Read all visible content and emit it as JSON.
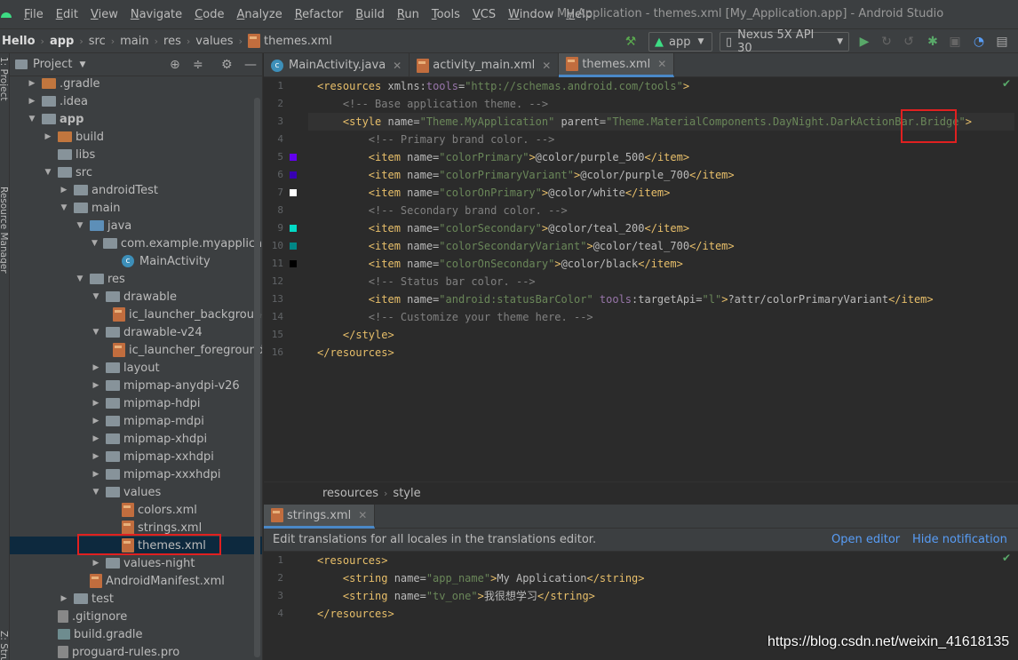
{
  "window": {
    "title": "My Application - themes.xml [My_Application.app] - Android Studio",
    "menus": [
      "File",
      "Edit",
      "View",
      "Navigate",
      "Code",
      "Analyze",
      "Refactor",
      "Build",
      "Run",
      "Tools",
      "VCS",
      "Window",
      "Help"
    ]
  },
  "breadcrumb": [
    "Hello",
    "app",
    "src",
    "main",
    "res",
    "values",
    "themes.xml"
  ],
  "toolbar": {
    "run_config": "app",
    "device": "Nexus 5X API 30"
  },
  "left_stripe": {
    "project": "1: Project",
    "resource_manager": "Resource Manager",
    "structure": "Z: Structure"
  },
  "project_panel": {
    "title": "Project",
    "tree": [
      {
        "label": ".gradle",
        "depth": 0,
        "arrow": "closed",
        "icon": "folder-orange"
      },
      {
        "label": ".idea",
        "depth": 0,
        "arrow": "closed",
        "icon": "folder"
      },
      {
        "label": "app",
        "depth": 0,
        "arrow": "open",
        "icon": "folder-module"
      },
      {
        "label": "build",
        "depth": 1,
        "arrow": "closed",
        "icon": "folder-orange"
      },
      {
        "label": "libs",
        "depth": 1,
        "arrow": "none",
        "icon": "folder"
      },
      {
        "label": "src",
        "depth": 1,
        "arrow": "open",
        "icon": "folder"
      },
      {
        "label": "androidTest",
        "depth": 2,
        "arrow": "closed",
        "icon": "folder"
      },
      {
        "label": "main",
        "depth": 2,
        "arrow": "open",
        "icon": "folder"
      },
      {
        "label": "java",
        "depth": 3,
        "arrow": "open",
        "icon": "folder-blue"
      },
      {
        "label": "com.example.myapplication",
        "depth": 4,
        "arrow": "open",
        "icon": "package"
      },
      {
        "label": "MainActivity",
        "depth": 5,
        "arrow": "none",
        "icon": "class"
      },
      {
        "label": "res",
        "depth": 3,
        "arrow": "open",
        "icon": "folder"
      },
      {
        "label": "drawable",
        "depth": 4,
        "arrow": "open",
        "icon": "folder"
      },
      {
        "label": "ic_launcher_background.xml",
        "depth": 5,
        "arrow": "none",
        "icon": "xml"
      },
      {
        "label": "drawable-v24",
        "depth": 4,
        "arrow": "open",
        "icon": "folder"
      },
      {
        "label": "ic_launcher_foreground.xml",
        "depth": 5,
        "arrow": "none",
        "icon": "xml"
      },
      {
        "label": "layout",
        "depth": 4,
        "arrow": "closed",
        "icon": "folder"
      },
      {
        "label": "mipmap-anydpi-v26",
        "depth": 4,
        "arrow": "closed",
        "icon": "folder"
      },
      {
        "label": "mipmap-hdpi",
        "depth": 4,
        "arrow": "closed",
        "icon": "folder"
      },
      {
        "label": "mipmap-mdpi",
        "depth": 4,
        "arrow": "closed",
        "icon": "folder"
      },
      {
        "label": "mipmap-xhdpi",
        "depth": 4,
        "arrow": "closed",
        "icon": "folder"
      },
      {
        "label": "mipmap-xxhdpi",
        "depth": 4,
        "arrow": "closed",
        "icon": "folder"
      },
      {
        "label": "mipmap-xxxhdpi",
        "depth": 4,
        "arrow": "closed",
        "icon": "folder"
      },
      {
        "label": "values",
        "depth": 4,
        "arrow": "open",
        "icon": "folder"
      },
      {
        "label": "colors.xml",
        "depth": 5,
        "arrow": "none",
        "icon": "xml"
      },
      {
        "label": "strings.xml",
        "depth": 5,
        "arrow": "none",
        "icon": "xml"
      },
      {
        "label": "themes.xml",
        "depth": 5,
        "arrow": "none",
        "icon": "xml",
        "selected": true
      },
      {
        "label": "values-night",
        "depth": 4,
        "arrow": "closed",
        "icon": "folder"
      },
      {
        "label": "AndroidManifest.xml",
        "depth": 3,
        "arrow": "none",
        "icon": "manifest"
      },
      {
        "label": "test",
        "depth": 2,
        "arrow": "closed",
        "icon": "folder"
      },
      {
        "label": ".gitignore",
        "depth": 1,
        "arrow": "none",
        "icon": "file"
      },
      {
        "label": "build.gradle",
        "depth": 1,
        "arrow": "none",
        "icon": "gradle"
      },
      {
        "label": "proguard-rules.pro",
        "depth": 1,
        "arrow": "none",
        "icon": "file"
      }
    ]
  },
  "editor_tabs": [
    {
      "label": "MainActivity.java",
      "icon": "class",
      "active": false
    },
    {
      "label": "activity_main.xml",
      "icon": "xml",
      "active": false
    },
    {
      "label": "themes.xml",
      "icon": "xml",
      "active": true
    }
  ],
  "themes_xml": {
    "lines": [
      [
        [
          "tg",
          "<resources "
        ],
        [
          "at",
          "xmlns:"
        ],
        [
          "ns",
          "tools"
        ],
        [
          "at",
          "="
        ],
        [
          "av",
          "\"http://schemas.android.com/tools\""
        ],
        [
          "tg",
          ">"
        ]
      ],
      [
        [
          "cm",
          "    <!-- Base application theme. -->"
        ]
      ],
      [
        [
          "tg",
          "    <style "
        ],
        [
          "at",
          "name="
        ],
        [
          "av",
          "\"Theme.MyApplication\""
        ],
        [
          "at",
          " parent="
        ],
        [
          "av",
          "\"Theme.MaterialComponents.DayNight.DarkActionBar.Bridge\""
        ],
        [
          "tg",
          ">"
        ]
      ],
      [
        [
          "cm",
          "        <!-- Primary brand color. -->"
        ]
      ],
      [
        [
          "tg",
          "        <item "
        ],
        [
          "at",
          "name="
        ],
        [
          "av",
          "\"colorPrimary\""
        ],
        [
          "tg",
          ">"
        ],
        [
          "at",
          "@color/purple_500"
        ],
        [
          "tg",
          "</item>"
        ]
      ],
      [
        [
          "tg",
          "        <item "
        ],
        [
          "at",
          "name="
        ],
        [
          "av",
          "\"colorPrimaryVariant\""
        ],
        [
          "tg",
          ">"
        ],
        [
          "at",
          "@color/purple_700"
        ],
        [
          "tg",
          "</item>"
        ]
      ],
      [
        [
          "tg",
          "        <item "
        ],
        [
          "at",
          "name="
        ],
        [
          "av",
          "\"colorOnPrimary\""
        ],
        [
          "tg",
          ">"
        ],
        [
          "at",
          "@color/white"
        ],
        [
          "tg",
          "</item>"
        ]
      ],
      [
        [
          "cm",
          "        <!-- Secondary brand color. -->"
        ]
      ],
      [
        [
          "tg",
          "        <item "
        ],
        [
          "at",
          "name="
        ],
        [
          "av",
          "\"colorSecondary\""
        ],
        [
          "tg",
          ">"
        ],
        [
          "at",
          "@color/teal_200"
        ],
        [
          "tg",
          "</item>"
        ]
      ],
      [
        [
          "tg",
          "        <item "
        ],
        [
          "at",
          "name="
        ],
        [
          "av",
          "\"colorSecondaryVariant\""
        ],
        [
          "tg",
          ">"
        ],
        [
          "at",
          "@color/teal_700"
        ],
        [
          "tg",
          "</item>"
        ]
      ],
      [
        [
          "tg",
          "        <item "
        ],
        [
          "at",
          "name="
        ],
        [
          "av",
          "\"colorOnSecondary\""
        ],
        [
          "tg",
          ">"
        ],
        [
          "at",
          "@color/black"
        ],
        [
          "tg",
          "</item>"
        ]
      ],
      [
        [
          "cm",
          "        <!-- Status bar color. -->"
        ]
      ],
      [
        [
          "tg",
          "        <item "
        ],
        [
          "at",
          "name="
        ],
        [
          "av",
          "\"android:statusBarColor\""
        ],
        [
          "at",
          " "
        ],
        [
          "ns",
          "tools"
        ],
        [
          "at",
          ":targetApi="
        ],
        [
          "av",
          "\"l\""
        ],
        [
          "tg",
          ">"
        ],
        [
          "at",
          "?attr/colorPrimaryVariant"
        ],
        [
          "tg",
          "</item>"
        ]
      ],
      [
        [
          "cm",
          "        <!-- Customize your theme here. -->"
        ]
      ],
      [
        [
          "tg",
          "    </style>"
        ]
      ],
      [
        [
          "tg",
          "</resources>"
        ]
      ]
    ],
    "swatches": {
      "5": "#6200ee",
      "6": "#3700b3",
      "7": "#ffffff",
      "9": "#03dac5",
      "10": "#018786",
      "11": "#000000"
    }
  },
  "editor_breadcrumb": [
    "resources",
    "style"
  ],
  "second_editor": {
    "tab": "strings.xml",
    "notification": "Edit translations for all locales in the translations editor.",
    "open_editor": "Open editor",
    "hide_notification": "Hide notification",
    "lines": [
      [
        [
          "tg",
          "<resources>"
        ]
      ],
      [
        [
          "tg",
          "    <string "
        ],
        [
          "at",
          "name="
        ],
        [
          "av",
          "\"app_name\""
        ],
        [
          "tg",
          ">"
        ],
        [
          "at",
          "My Application"
        ],
        [
          "tg",
          "</string>"
        ]
      ],
      [
        [
          "tg",
          "    <string "
        ],
        [
          "at",
          "name="
        ],
        [
          "av",
          "\"tv_one\""
        ],
        [
          "tg",
          ">"
        ],
        [
          "at",
          "我很想学习"
        ],
        [
          "tg",
          "</string>"
        ]
      ],
      [
        [
          "tg",
          "</resources>"
        ]
      ]
    ]
  },
  "watermark": "https://blog.csdn.net/weixin_41618135",
  "colors": {
    "accent": "#4a88c7",
    "annotation": "#e02020",
    "selection": "#0d293e"
  }
}
